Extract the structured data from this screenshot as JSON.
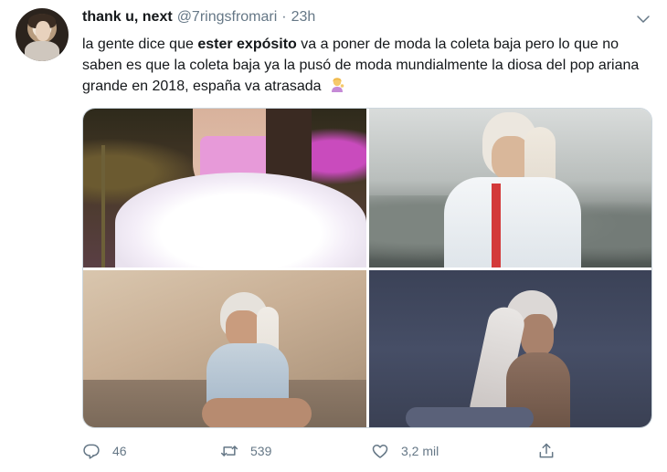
{
  "tweet": {
    "display_name": "thank u, next",
    "handle": "@7ringsfromari",
    "separator": "·",
    "time": "23h",
    "text_part1": "la gente dice que ",
    "text_bold": "ester expósito",
    "text_part2": " va a poner de moda la coleta baja pero lo que no saben es que la coleta baja ya la pusó de moda mundialmente la diosa del pop ariana grande en 2018, españa va atrasada",
    "emoji": "woman-tipping-hand-emoji"
  },
  "media": {
    "photos": [
      {
        "name": "photo-concert-white-fur"
      },
      {
        "name": "photo-white-puffer-jacket"
      },
      {
        "name": "photo-sitting-beige"
      },
      {
        "name": "photo-blue-background-ponytail"
      }
    ]
  },
  "actions": {
    "reply_count": "46",
    "retweet_count": "539",
    "like_count": "3,2 mil",
    "icons": [
      "reply-icon",
      "retweet-icon",
      "like-icon",
      "share-icon"
    ]
  },
  "colors": {
    "text": "#14171a",
    "secondary": "#657786",
    "border": "#ccd6dd"
  }
}
